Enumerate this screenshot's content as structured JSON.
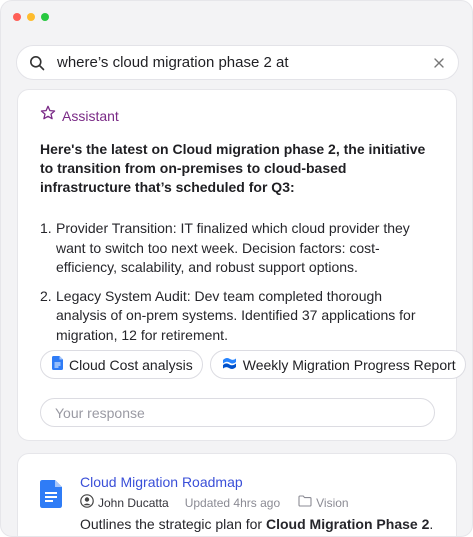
{
  "search": {
    "query": "where’s cloud migration phase 2 at",
    "search_icon": "search-icon",
    "clear_icon": "close-icon"
  },
  "assistant": {
    "label": "Assistant",
    "icon": "star-icon",
    "accent": "#7a2a86",
    "intro": "Here's the latest on Cloud migration phase 2, the initiative to transition from on-premises to cloud-based infrastructure that’s scheduled for Q3:",
    "items": [
      {
        "num": "1.",
        "text": "Provider Transition: IT finalized which cloud provider they want to switch too next week. Decision factors: cost-efficiency, scalability, and robust support options."
      },
      {
        "num": "2.",
        "text": "Legacy System Audit: Dev team completed thorough analysis of on-prem systems. Identified 37 applications for migration, 12 for retirement."
      }
    ],
    "chips": [
      {
        "label": "Cloud Cost analysis",
        "icon": "google-docs-icon"
      },
      {
        "label": "Weekly Migration Progress Report",
        "icon": "confluence-icon"
      }
    ],
    "response_placeholder": "Your response"
  },
  "result": {
    "title": "Cloud Migration Roadmap",
    "icon": "google-docs-icon",
    "author": "John Ducatta",
    "updated": "Updated 4hrs ago",
    "folder": "Vision",
    "desc_prefix": "Outlines the strategic plan for ",
    "desc_bold": "Cloud Migration Phase 2",
    "desc_suffix": ".",
    "link_color": "#3a4fd8"
  }
}
